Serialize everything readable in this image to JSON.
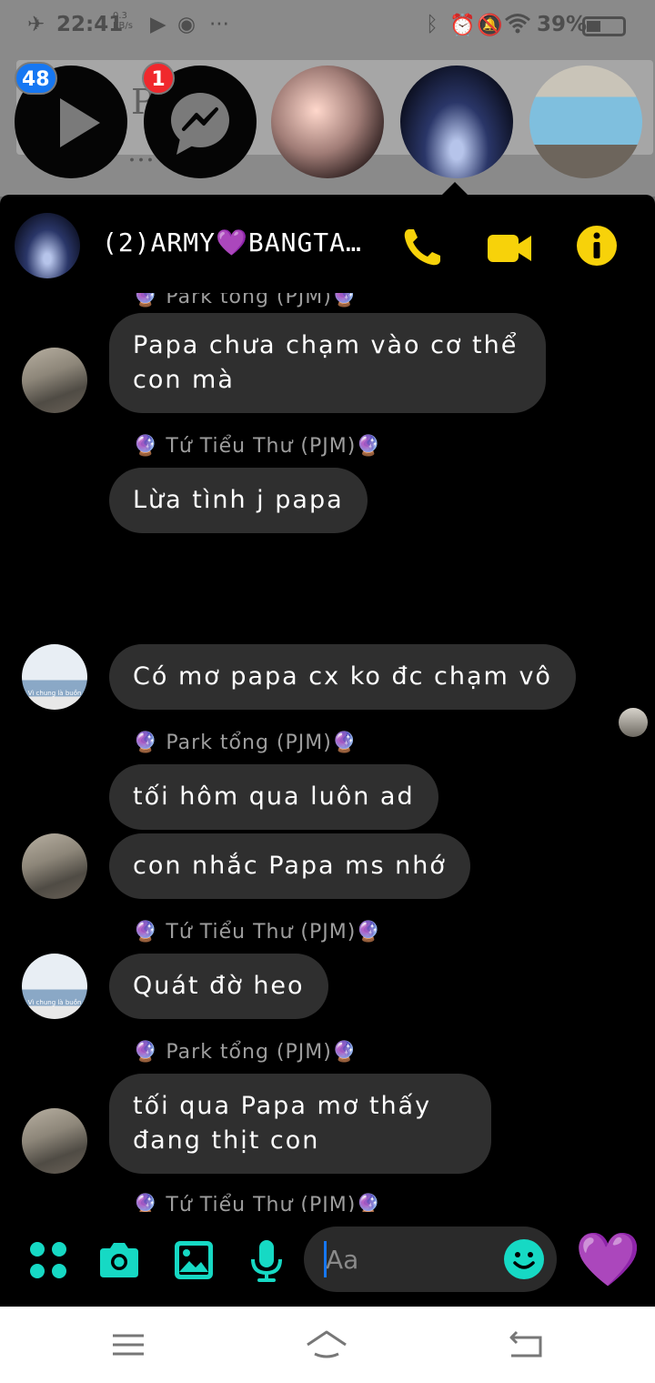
{
  "status_bar": {
    "time": "22:41",
    "speed": "0.3 KB/s",
    "dots": "···",
    "battery": "39%"
  },
  "chat_heads": {
    "player_badge": "48",
    "messenger_badge": "1"
  },
  "background_app": {
    "text_line_1": "P…",
    "text_line_2": "…"
  },
  "header": {
    "title": "(2)ARMY💜BANGTAN..."
  },
  "messages": [
    {
      "sender": "🔮 Park tổng (PJM)🔮",
      "text": "Papa chưa chạm vào cơ thể con mà"
    },
    {
      "sender": "🔮 Tứ Tiểu Thư (PJM)🔮",
      "text": "Lừa tình j papa"
    },
    {
      "text": "Có mơ papa cx ko đc chạm vô"
    },
    {
      "sender": "🔮 Park tổng (PJM)🔮",
      "text": "tối hôm qua luôn ad"
    },
    {
      "text": "con nhắc Papa ms nhớ"
    },
    {
      "sender": "🔮 Tứ Tiểu Thư (PJM)🔮",
      "text": "Quát đờ heo"
    },
    {
      "sender": "🔮 Park tổng (PJM)🔮",
      "text": "tối qua Papa mơ thấy đang thịt con"
    },
    {
      "sender": "🔮 Tứ Tiểu Thư (PJM)🔮"
    }
  ],
  "reactions": {
    "emoji_1": "😠",
    "emoji_2": "😠"
  },
  "avatar_captions": {
    "caption_b": "Vì chung là buồn"
  },
  "composer": {
    "placeholder": "Aa",
    "like_emoji": "💜"
  },
  "colors": {
    "accent_yellow": "#f7d20a",
    "accent_teal": "#16d9c4",
    "bubble": "#2f2f2f",
    "badge_blue": "#1677f2",
    "badge_red": "#f0282d"
  },
  "icons": [
    "airplane-icon",
    "bluetooth-icon",
    "alarm-icon",
    "mute-icon",
    "wifi-icon",
    "battery-icon",
    "play-icon",
    "messenger-icon",
    "call-icon",
    "video-icon",
    "info-icon",
    "more-icon",
    "camera-icon",
    "gallery-icon",
    "mic-icon",
    "emoji-icon",
    "arrow-down-icon",
    "menu-icon",
    "home-icon",
    "back-icon"
  ]
}
